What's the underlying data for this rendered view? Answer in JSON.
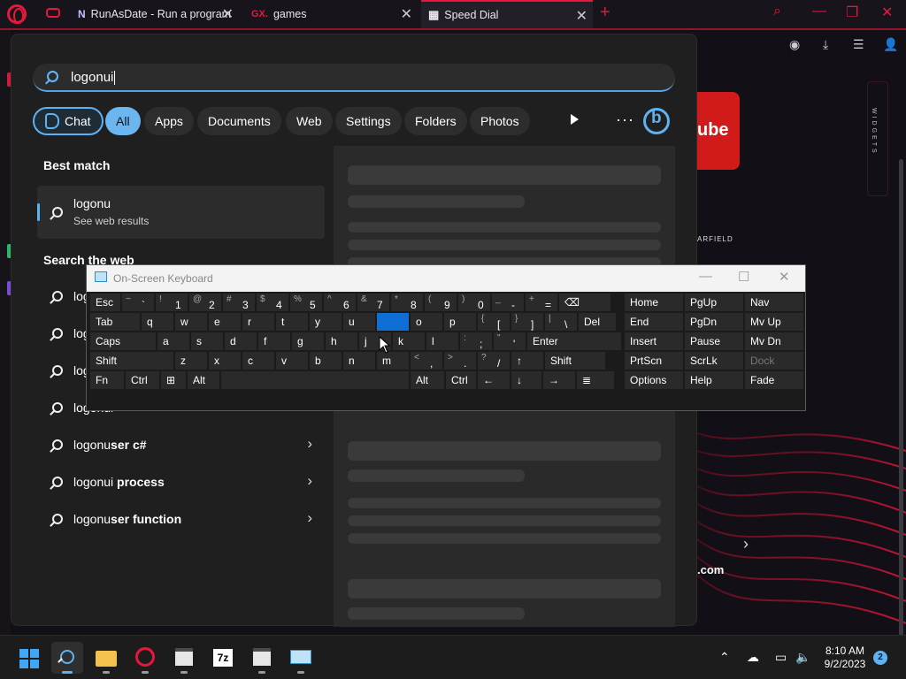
{
  "browser": {
    "tabs": [
      {
        "favicon": "N",
        "title": "RunAsDate - Run a program"
      },
      {
        "favicon": "GX.",
        "title": "games"
      },
      {
        "favicon": "▦",
        "title": "Speed Dial"
      }
    ],
    "speed_dial": {
      "youtube_label": "ube",
      "starfield_label": "ARFIELD",
      "widgets_label": "WIDGETS",
      "dotcom_label": ".com"
    },
    "accent_color": "#e8173b"
  },
  "search": {
    "query": "logonui",
    "filters": [
      "Chat",
      "All",
      "Apps",
      "Documents",
      "Web",
      "Settings",
      "Folders",
      "Photos"
    ],
    "selected_filter": "All",
    "best_match_heading": "Best match",
    "best_match": {
      "title": "logonu",
      "subtitle": "See web results"
    },
    "web_heading": "Search the web",
    "web_results": [
      {
        "bold_prefix": "",
        "rest": "logonui"
      },
      {
        "bold_prefix": "",
        "rest": "logonui"
      },
      {
        "bold_prefix": "",
        "rest": "logonui"
      },
      {
        "bold_prefix": "",
        "rest": "logonui"
      },
      {
        "prefix": "logonu",
        "suffix": "ser c#"
      },
      {
        "prefix": "logonui",
        "suffix": " process"
      },
      {
        "prefix": "logonu",
        "suffix": "ser function"
      }
    ]
  },
  "osk": {
    "title": "On-Screen Keyboard",
    "rows": [
      [
        "Esc",
        "~ `",
        "! 1",
        "@ 2",
        "# 3",
        "$ 4",
        "% 5",
        "^ 6",
        "& 7",
        "* 8",
        "( 9",
        ") 0",
        "_ -",
        "+ =",
        "⌫"
      ],
      [
        "Tab",
        "q",
        "w",
        "e",
        "r",
        "t",
        "y",
        "u",
        "i",
        "o",
        "p",
        "{ [",
        "} ]",
        "| \\",
        "Del"
      ],
      [
        "Caps",
        "a",
        "s",
        "d",
        "f",
        "g",
        "h",
        "j",
        "k",
        "l",
        ": ;",
        "\" '",
        "Enter"
      ],
      [
        "Shift",
        "z",
        "x",
        "c",
        "v",
        "b",
        "n",
        "m",
        "< ,",
        "> .",
        "? /",
        "↑",
        "Shift"
      ],
      [
        "Fn",
        "Ctrl",
        "⊞",
        "Alt",
        "",
        "Alt",
        "Ctrl",
        "←",
        "↓",
        "→",
        "≣"
      ]
    ],
    "nav_keys": [
      [
        "Home",
        "PgUp",
        "Nav"
      ],
      [
        "End",
        "PgDn",
        "Mv Up"
      ],
      [
        "Insert",
        "Pause",
        "Mv Dn"
      ],
      [
        "PrtScn",
        "ScrLk",
        "Dock"
      ],
      [
        "Options",
        "Help",
        "Fade"
      ]
    ],
    "highlighted_key": "i"
  },
  "taskbar": {
    "time": "8:10 AM",
    "date": "9/2/2023",
    "notification_count": "2",
    "apps": [
      "start-icon",
      "search-icon",
      "file-explorer-icon",
      "opera-gx-icon",
      "calendar-app-icon",
      "7zip-icon",
      "calendar-app-icon-2",
      "onscreen-keyboard-icon"
    ]
  }
}
